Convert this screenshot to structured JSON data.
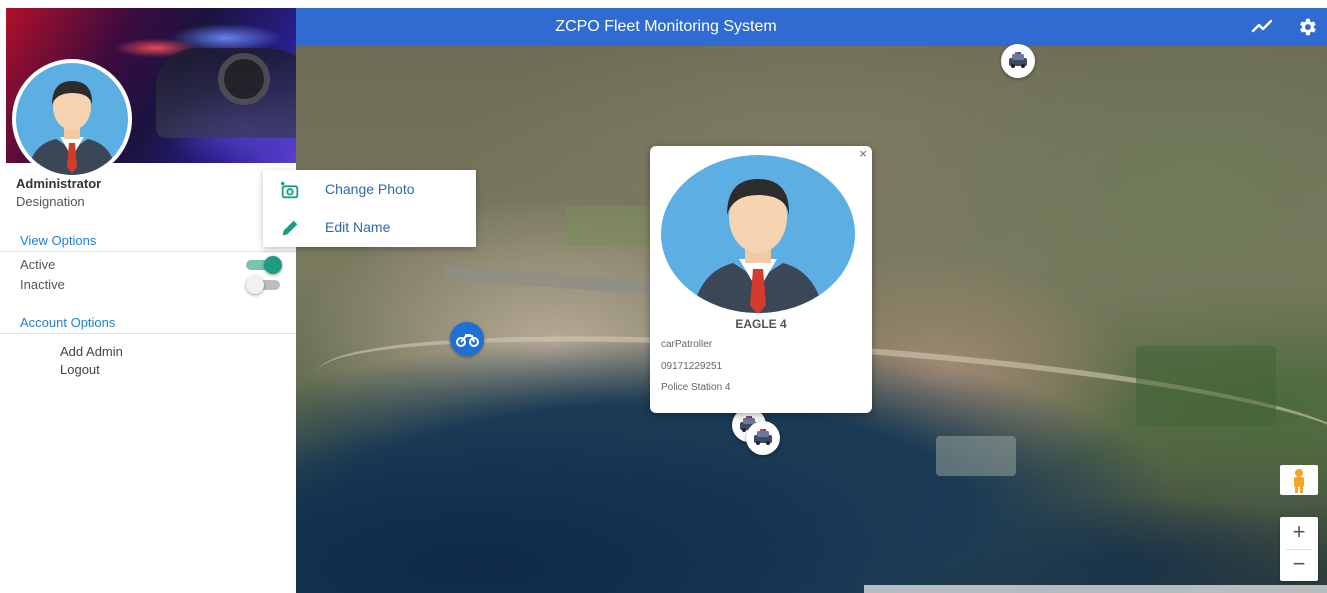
{
  "app": {
    "title": "ZCPO Fleet Monitoring System"
  },
  "colors": {
    "topbar": "#2f6bd0",
    "toggle_on": "#1e9c83",
    "link": "#1f7fd8"
  },
  "icons": {
    "topbar": [
      "trending-icon",
      "gear-icon"
    ],
    "menu": [
      "add-photo-icon",
      "pencil-icon"
    ],
    "markers": [
      "police-car-icon",
      "motorcycle-icon"
    ]
  },
  "profile": {
    "name": "Administrator",
    "designation": "Designation"
  },
  "view_options": {
    "title": "View Options",
    "items": [
      {
        "label": "Active",
        "state": "on"
      },
      {
        "label": "Inactive",
        "state": "off"
      }
    ]
  },
  "account_options": {
    "title": "Account Options",
    "items": [
      "Add Admin",
      "Logout"
    ]
  },
  "photo_menu": {
    "items": [
      "Change Photo",
      "Edit Name"
    ]
  },
  "popup": {
    "close": "×",
    "title": "EAGLE 4",
    "type": "carPatroller",
    "phone": "09171229251",
    "station": "Police Station 4"
  },
  "map_controls": {
    "zoom_in": "+",
    "zoom_out": "−"
  }
}
